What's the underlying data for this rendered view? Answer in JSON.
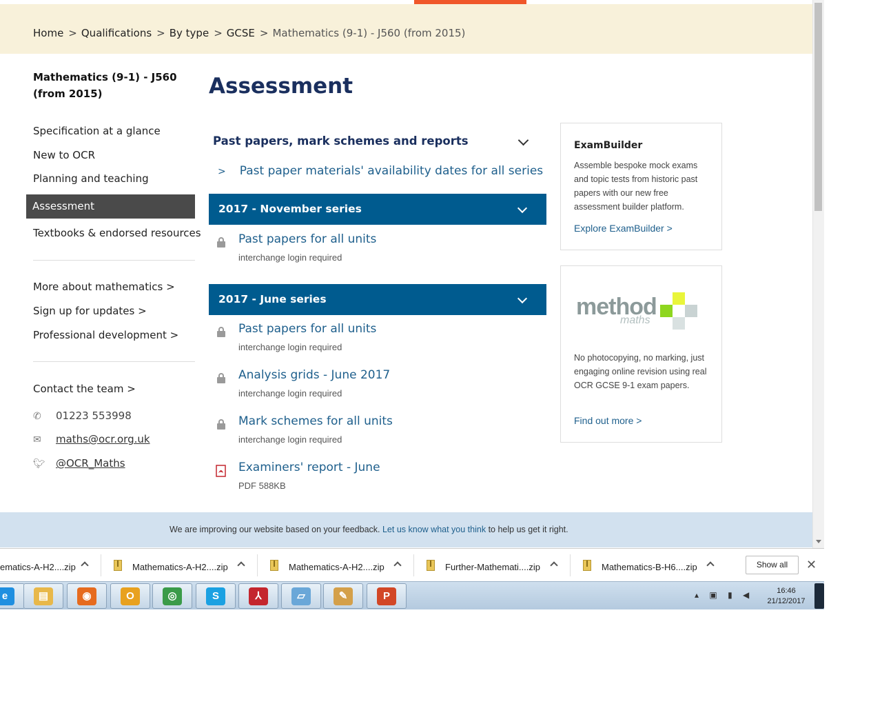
{
  "breadcrumb": {
    "home": "Home",
    "qualifications": "Qualifications",
    "by_type": "By type",
    "gcse": "GCSE",
    "current": "Mathematics (9-1) - J560 (from 2015)",
    "separator": ">"
  },
  "sidebar": {
    "title_line1": "Mathematics (9-1) - J560",
    "title_line2": "(from 2015)",
    "items": [
      {
        "label": "Specification at a glance"
      },
      {
        "label": "New to OCR"
      },
      {
        "label": "Planning and teaching"
      },
      {
        "label": "Assessment"
      },
      {
        "label": "Textbooks & endorsed resources"
      }
    ],
    "more_links": [
      {
        "label": "More about mathematics >"
      },
      {
        "label": "Sign up for updates >"
      },
      {
        "label": "Professional development >"
      }
    ],
    "contact_label": "Contact the team >",
    "phone": "01223 553998",
    "email": "maths@ocr.org.uk",
    "twitter": "@OCR_Maths"
  },
  "main": {
    "title": "Assessment",
    "accordion_title": "Past papers, mark schemes and reports",
    "availability_link": "Past paper materials' availability dates for all series",
    "series": [
      {
        "label": "2017 - November series",
        "items": [
          {
            "title": "Past papers for all units",
            "sub": "interchange login required"
          }
        ]
      },
      {
        "label": "2017 - June series",
        "items": [
          {
            "title": "Past papers for all units",
            "sub": "interchange login required"
          },
          {
            "title": "Analysis grids - June 2017",
            "sub": "interchange login required"
          },
          {
            "title": "Mark schemes for all units",
            "sub": "interchange login required"
          },
          {
            "title": "Examiners' report - June",
            "sub": "PDF 588KB"
          }
        ]
      }
    ]
  },
  "cards": {
    "exambuilder": {
      "title": "ExamBuilder",
      "text": "Assemble bespoke mock exams and topic tests from historic past papers with our new free assessment builder platform.",
      "link": "Explore ExamBuilder >"
    },
    "method": {
      "logo_word": "method",
      "logo_sub": "maths",
      "text": "No photocopying, no marking, just engaging online revision using real OCR GCSE 9-1 exam papers.",
      "link": "Find out more >"
    }
  },
  "feedback": {
    "before": "We are improving our website based on your feedback.",
    "link": "Let us know what you think",
    "after": "to help us get it right."
  },
  "downloads": {
    "files": [
      {
        "name": "ematics-A-H2....zip"
      },
      {
        "name": "Mathematics-A-H2....zip"
      },
      {
        "name": "Mathematics-A-H2....zip"
      },
      {
        "name": "Further-Mathemati....zip"
      },
      {
        "name": "Mathematics-B-H6....zip"
      }
    ],
    "show_all": "Show all",
    "close": "✕"
  },
  "taskbar": {
    "apps": [
      {
        "icon": "internet-explorer-icon",
        "glyph": "e",
        "color": "#1f8fe0"
      },
      {
        "icon": "file-explorer-icon",
        "glyph": "▤",
        "color": "#e8b84a"
      },
      {
        "icon": "firefox-icon",
        "glyph": "◉",
        "color": "#e66b1f"
      },
      {
        "icon": "outlook-icon",
        "glyph": "O",
        "color": "#e8a11f"
      },
      {
        "icon": "chrome-icon",
        "glyph": "◎",
        "color": "#3a9b49"
      },
      {
        "icon": "skype-icon",
        "glyph": "S",
        "color": "#1ba1e2"
      },
      {
        "icon": "acrobat-icon",
        "glyph": "⅄",
        "color": "#c4262e"
      },
      {
        "icon": "notepad-icon",
        "glyph": "▱",
        "color": "#6aa7d8"
      },
      {
        "icon": "paint-icon",
        "glyph": "✎",
        "color": "#d4a04a"
      },
      {
        "icon": "powerpoint-icon",
        "glyph": "P",
        "color": "#d24726"
      }
    ],
    "time": "16:46",
    "date": "21/12/2017"
  },
  "colors": {
    "accent": "#f0572a",
    "series_bar": "#005b8f",
    "link": "#1e5f8c",
    "title": "#1a2f5e",
    "breadcrumb_bg": "#f8f1da",
    "feedback_bg": "#d2e1ef"
  }
}
